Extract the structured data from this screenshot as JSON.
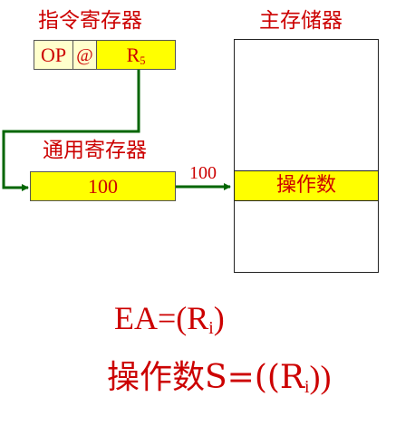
{
  "ir_label": "指令寄存器",
  "ir_fields": {
    "op": "OP",
    "at": "@",
    "reg": "R",
    "reg_sub": "5"
  },
  "gpr_label": "通用寄存器",
  "gpr_value": "100",
  "address_label": "100",
  "memory_label": "主存储器",
  "operand_label": "操作数",
  "ea_formula": {
    "prefix": "EA=(R",
    "sub": "i",
    "suffix": ")"
  },
  "operand_formula": {
    "prefix": "操作数S=((R",
    "sub": "i",
    "suffix": "))"
  },
  "colors": {
    "text": "#cc0000",
    "field_yellow": "#ffff00",
    "field_cream": "#ffffcc",
    "wire_green": "#006600",
    "border": "#555555"
  }
}
